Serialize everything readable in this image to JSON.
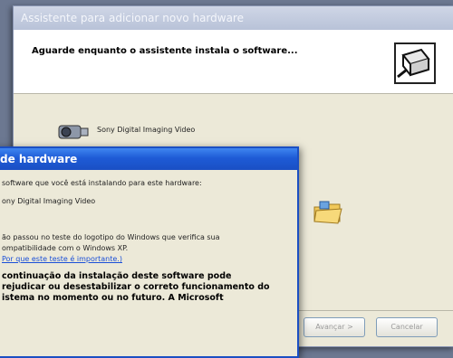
{
  "wizard": {
    "title": "Assistente para adicionar novo hardware",
    "heading": "Aguarde enquanto o assistente instala o software...",
    "device_name": "Sony Digital Imaging Video",
    "buttons": {
      "next": "Avançar >",
      "cancel": "Cancelar"
    }
  },
  "dialog": {
    "title": "de hardware",
    "line1": "software que você está instalando para este hardware:",
    "device": "ony Digital Imaging Video",
    "line2": "ão passou no teste do logotipo do Windows que verifica sua",
    "line3": "ompatibilidade com o Windows XP.",
    "link": "Por que este teste é importante.)",
    "warning_1": "continuação da instalação deste software pode",
    "warning_2": "rejudicar ou desestabilizar o correto funcionamento do",
    "warning_3": "istema no momento ou no futuro. A Microsoft"
  }
}
